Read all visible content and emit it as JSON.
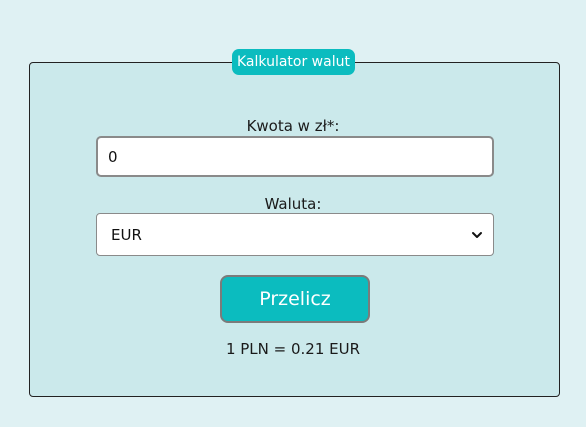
{
  "calculator": {
    "title": "Kalkulator walut",
    "amount_label": "Kwota w zł*:",
    "amount_value": "0",
    "currency_label": "Waluta:",
    "currency_selected": "EUR",
    "convert_button": "Przelicz",
    "result_text": "1 PLN = 0.21 EUR"
  },
  "colors": {
    "accent": "#0bbcbf",
    "panel": "#cbe9eb",
    "page": "#dff1f3"
  }
}
